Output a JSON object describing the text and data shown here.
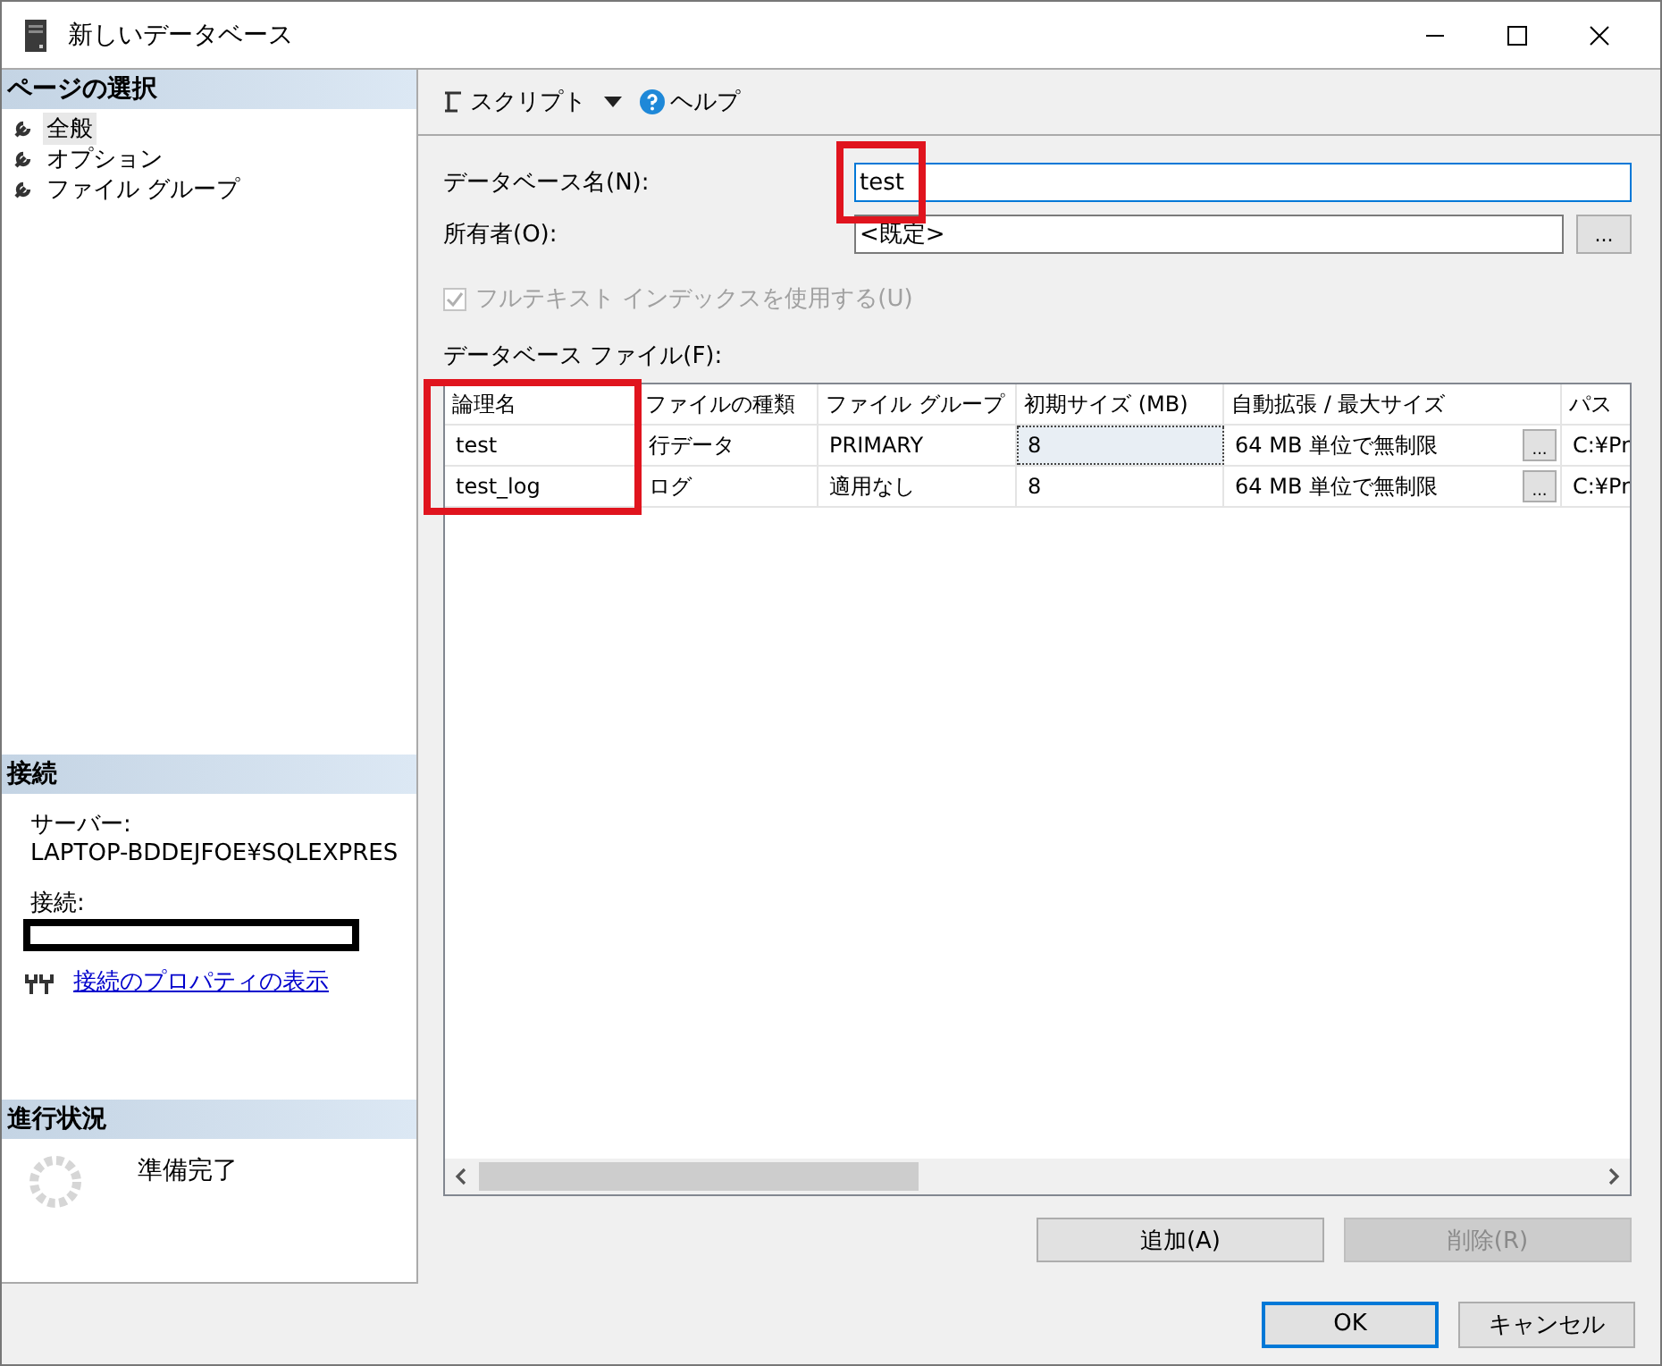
{
  "window": {
    "title": "新しいデータベース"
  },
  "sidebar": {
    "title": "ページの選択",
    "items": [
      {
        "label": "全般",
        "selected": true
      },
      {
        "label": "オプション",
        "selected": false
      },
      {
        "label": "ファイル グループ",
        "selected": false
      }
    ]
  },
  "connection": {
    "title": "接続",
    "server_label": "サーバー:",
    "server": "LAPTOP-BDDEJFOE¥SQLEXPRES",
    "connection_label": "接続:",
    "redacted": true,
    "link": "接続のプロパティの表示"
  },
  "progress": {
    "title": "進行状況",
    "status": "準備完了"
  },
  "toolbar": {
    "script": "スクリプト",
    "help": "ヘルプ"
  },
  "form": {
    "name_label": "データベース名(N):",
    "name_value": "test",
    "name_highlighted": true,
    "owner_label": "所有者(O):",
    "owner_value": "<既定>",
    "owner_button": "...",
    "fulltext": {
      "label": "フルテキスト インデックスを使用する(U)",
      "checked": true,
      "disabled": true
    }
  },
  "files": {
    "label": "データベース ファイル(F):",
    "columns": [
      {
        "label": "論理名",
        "highlighted": true
      },
      {
        "label": "ファイルの種類",
        "highlighted": false
      },
      {
        "label": "ファイル グループ",
        "highlighted": false
      },
      {
        "label": "初期サイズ (MB)",
        "highlighted": false
      },
      {
        "label": "自動拡張 / 最大サイズ",
        "highlighted": false
      },
      {
        "label": "パス",
        "highlighted": false
      }
    ],
    "rows": [
      {
        "cells": [
          "test",
          "行データ",
          "PRIMARY",
          "8",
          "64 MB 単位で無制限",
          "C:¥Pr"
        ],
        "button": "...",
        "focused": true
      },
      {
        "cells": [
          "test_log",
          "ログ",
          "適用なし",
          "8",
          "64 MB 単位で無制限",
          "C:¥Pr"
        ],
        "button": "...",
        "focused": false
      }
    ]
  },
  "buttons": [
    {
      "label": "追加(A)",
      "disabled": false
    },
    {
      "label": "削除(R)",
      "disabled": true
    }
  ],
  "dialog_buttons": [
    {
      "label": "OK",
      "default": true
    },
    {
      "label": "キャンセル",
      "default": false
    }
  ]
}
